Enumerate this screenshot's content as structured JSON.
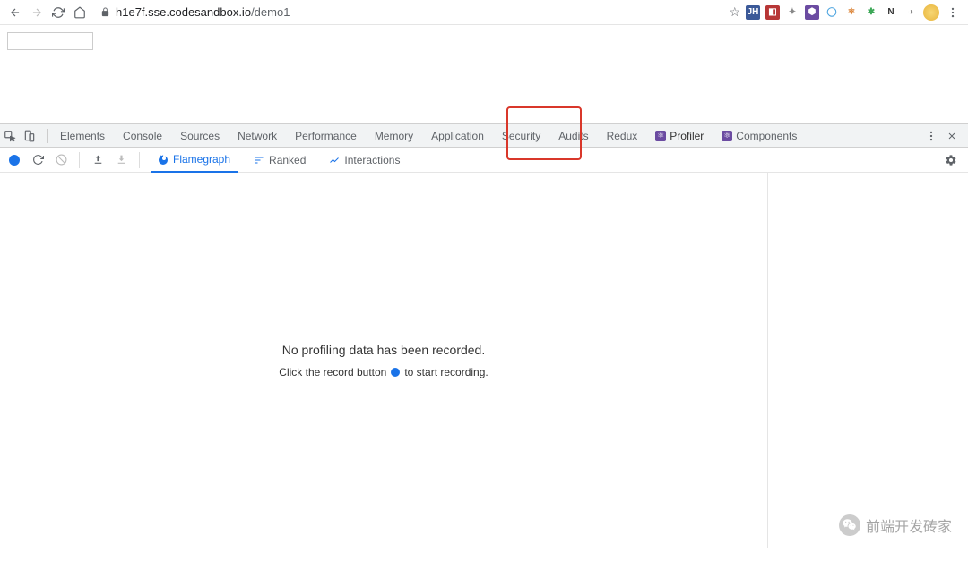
{
  "browser": {
    "url_host": "h1e7f.sse.codesandbox.io",
    "url_path": "/demo1",
    "extensions": [
      {
        "bg": "#3b5998",
        "fg": "#fff",
        "txt": "JH"
      },
      {
        "bg": "#b73636",
        "fg": "#fff",
        "txt": "◧"
      },
      {
        "bg": "#fff",
        "fg": "#888",
        "txt": "✦"
      },
      {
        "bg": "#6b4ba1",
        "fg": "#fff",
        "txt": "⬢"
      },
      {
        "bg": "#fff",
        "fg": "#4aa3df",
        "txt": "◯"
      },
      {
        "bg": "#fff",
        "fg": "#d97b29",
        "txt": "⚛"
      },
      {
        "bg": "#fff",
        "fg": "#3da858",
        "txt": "✱"
      },
      {
        "bg": "#fff",
        "fg": "#333",
        "txt": "N"
      },
      {
        "bg": "#fff",
        "fg": "#888",
        "txt": "◑"
      }
    ]
  },
  "devtools": {
    "tabs": [
      "Elements",
      "Console",
      "Sources",
      "Network",
      "Performance",
      "Memory",
      "Application",
      "Security",
      "Audits",
      "Redux"
    ],
    "react_tabs": {
      "profiler": "Profiler",
      "components": "Components"
    }
  },
  "profiler": {
    "tabs": {
      "flamegraph": "Flamegraph",
      "ranked": "Ranked",
      "interactions": "Interactions"
    },
    "empty_title": "No profiling data has been recorded.",
    "empty_sub_before": "Click the record button",
    "empty_sub_after": "to start recording."
  },
  "watermark": {
    "text": "前端开发砖家"
  }
}
